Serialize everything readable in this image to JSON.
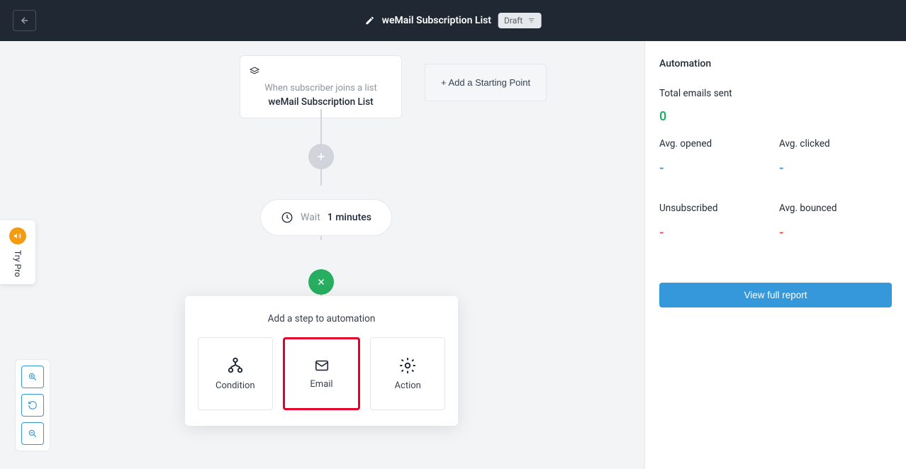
{
  "header": {
    "title": "weMail Subscription List",
    "status_badge": "Draft"
  },
  "flow": {
    "trigger": {
      "subtitle": "When subscriber joins a list",
      "list_name": "weMail Subscription List"
    },
    "add_starting_point": "+ Add a Starting Point",
    "wait": {
      "label": "Wait",
      "duration": "1 minutes"
    },
    "step_panel": {
      "title": "Add a step to automation",
      "options": [
        {
          "label": "Condition",
          "highlighted": false
        },
        {
          "label": "Email",
          "highlighted": true
        },
        {
          "label": "Action",
          "highlighted": false
        }
      ]
    }
  },
  "sidebar": {
    "heading": "Automation",
    "total_label": "Total emails sent",
    "total_value": "0",
    "stats": {
      "avg_opened": {
        "label": "Avg. opened",
        "value": "-"
      },
      "avg_clicked": {
        "label": "Avg. clicked",
        "value": "-"
      },
      "unsubscribed": {
        "label": "Unsubscribed",
        "value": "-"
      },
      "avg_bounced": {
        "label": "Avg. bounced",
        "value": "-"
      }
    },
    "report_button": "View full report"
  },
  "trypro_label": "Try Pro"
}
